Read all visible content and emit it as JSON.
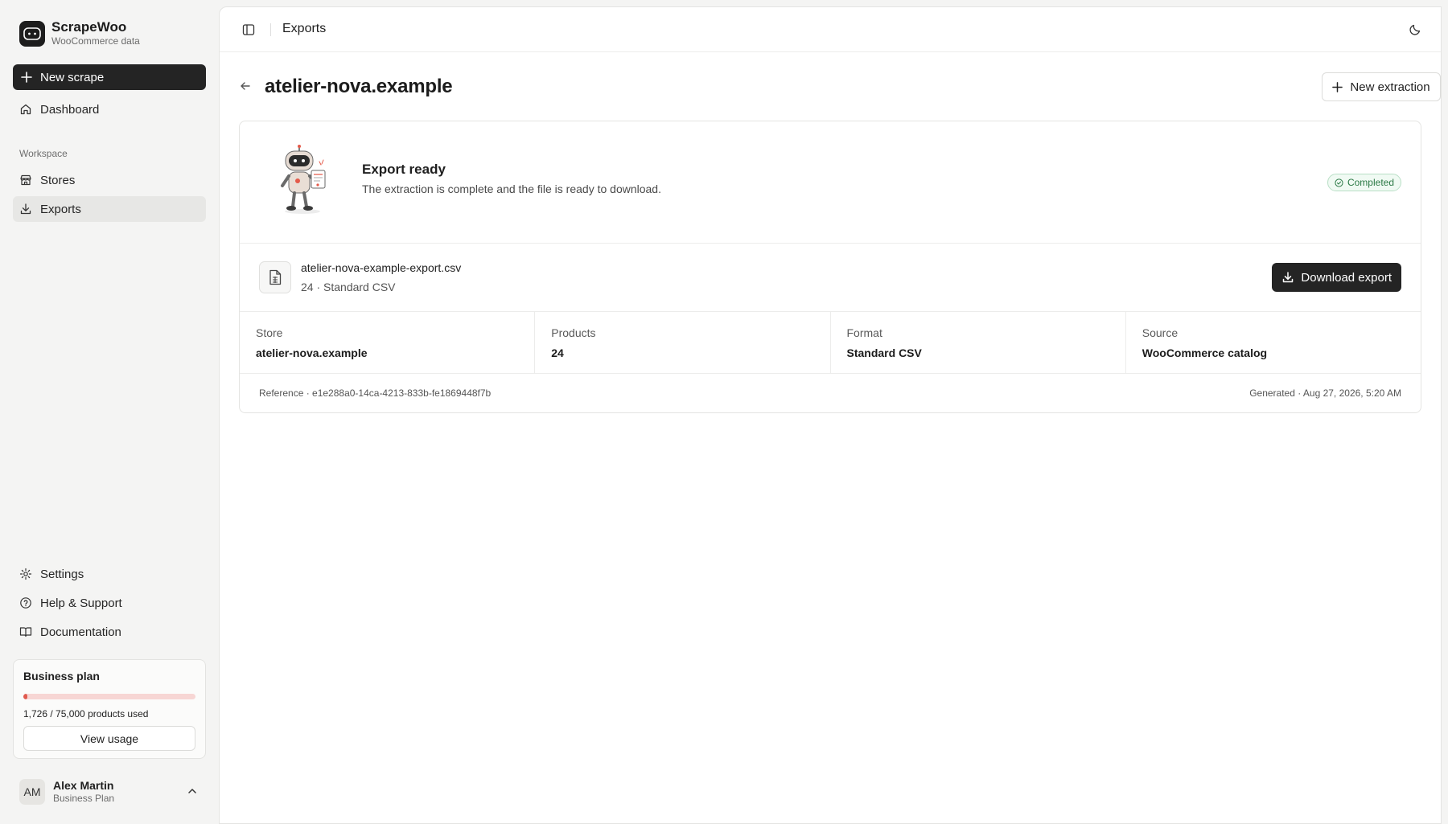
{
  "brand": {
    "name": "ScrapeWoo",
    "subtitle": "WooCommerce data"
  },
  "sidebar": {
    "new_scrape_label": "New scrape",
    "dashboard_label": "Dashboard",
    "section_label": "Workspace",
    "items": [
      {
        "label": "Stores",
        "icon": "store-icon"
      },
      {
        "label": "Exports",
        "icon": "download-icon",
        "active": true
      }
    ],
    "bottom_items": [
      {
        "label": "Settings",
        "icon": "gear-icon"
      },
      {
        "label": "Help & Support",
        "icon": "help-circle-icon"
      },
      {
        "label": "Documentation",
        "icon": "book-icon"
      }
    ],
    "plan": {
      "title": "Business plan",
      "usage_text": "1,726 / 75,000 products used",
      "usage_fraction": 0.023,
      "button_label": "View usage"
    },
    "user": {
      "initials": "AM",
      "name": "Alex Martin",
      "plan": "Business Plan"
    }
  },
  "topbar": {
    "title": "Exports"
  },
  "page": {
    "title": "atelier-nova.example",
    "new_extraction_label": "New extraction"
  },
  "export": {
    "status_title": "Export ready",
    "status_description": "The extraction is complete and the file is ready to download.",
    "badge": "Completed",
    "file_name": "atelier-nova-example-export.csv",
    "file_meta": "24 · Standard CSV",
    "download_label": "Download export",
    "stats": [
      {
        "label": "Store",
        "value": "atelier-nova.example"
      },
      {
        "label": "Products",
        "value": "24"
      },
      {
        "label": "Format",
        "value": "Standard CSV"
      },
      {
        "label": "Source",
        "value": "WooCommerce catalog"
      }
    ],
    "reference": "Reference · e1e288a0-14ca-4213-833b-fe1869448f7b",
    "generated": "Generated · Aug 27, 2026, 5:20 AM"
  },
  "colors": {
    "primary_button": "#242424",
    "badge_green": "#2c7a46",
    "usage_bar": "#e05a4e"
  }
}
